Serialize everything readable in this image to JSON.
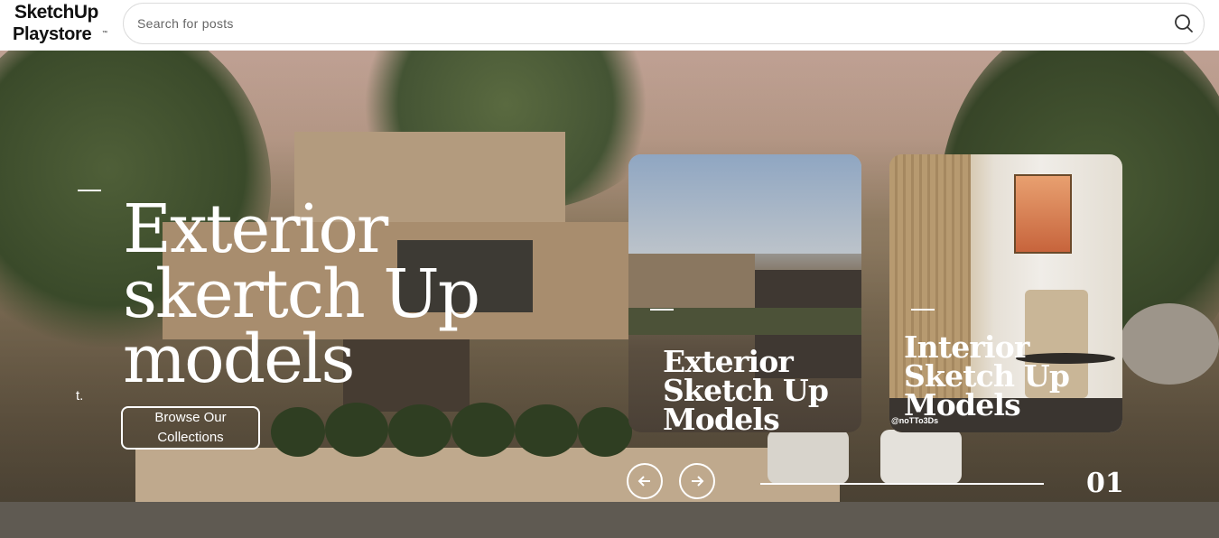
{
  "logo": {
    "line1": "SketchUp",
    "line2": "Playstore",
    "tm": "™"
  },
  "search": {
    "placeholder": "Search for posts",
    "value": "",
    "icon": "search-icon"
  },
  "hero": {
    "title": "Exterior skertch Up models",
    "stray_text": "t.",
    "browse_label": "Browse Our Collections"
  },
  "cards": [
    {
      "title": "Exterior Sketch Up Models"
    },
    {
      "title": "Interior Sketch Up Models",
      "watermark": "@noTTo3Ds"
    }
  ],
  "slider": {
    "prev_icon": "arrow-left-icon",
    "next_icon": "arrow-right-icon",
    "counter": "01",
    "progress": 1.0
  },
  "colors": {
    "text_on_image": "#ffffff",
    "header_bg": "#ffffff"
  }
}
